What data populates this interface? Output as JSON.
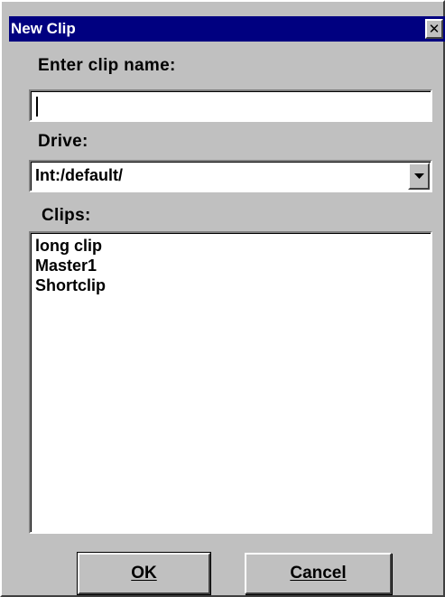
{
  "window": {
    "title": "New Clip",
    "close_glyph": "✕"
  },
  "name_section": {
    "label": "Enter clip name:",
    "value": ""
  },
  "drive_section": {
    "label": "Drive:",
    "selected": "Int:/default/",
    "dropdown_icon": "chevron-down-icon"
  },
  "clips_section": {
    "label": "Clips:",
    "items": [
      "long clip",
      "Master1",
      "Shortclip"
    ]
  },
  "buttons": {
    "ok_label": "OK",
    "cancel_label": "Cancel"
  },
  "colors": {
    "titlebar": "#000080",
    "face": "#c0c0c0",
    "field": "#ffffff"
  }
}
